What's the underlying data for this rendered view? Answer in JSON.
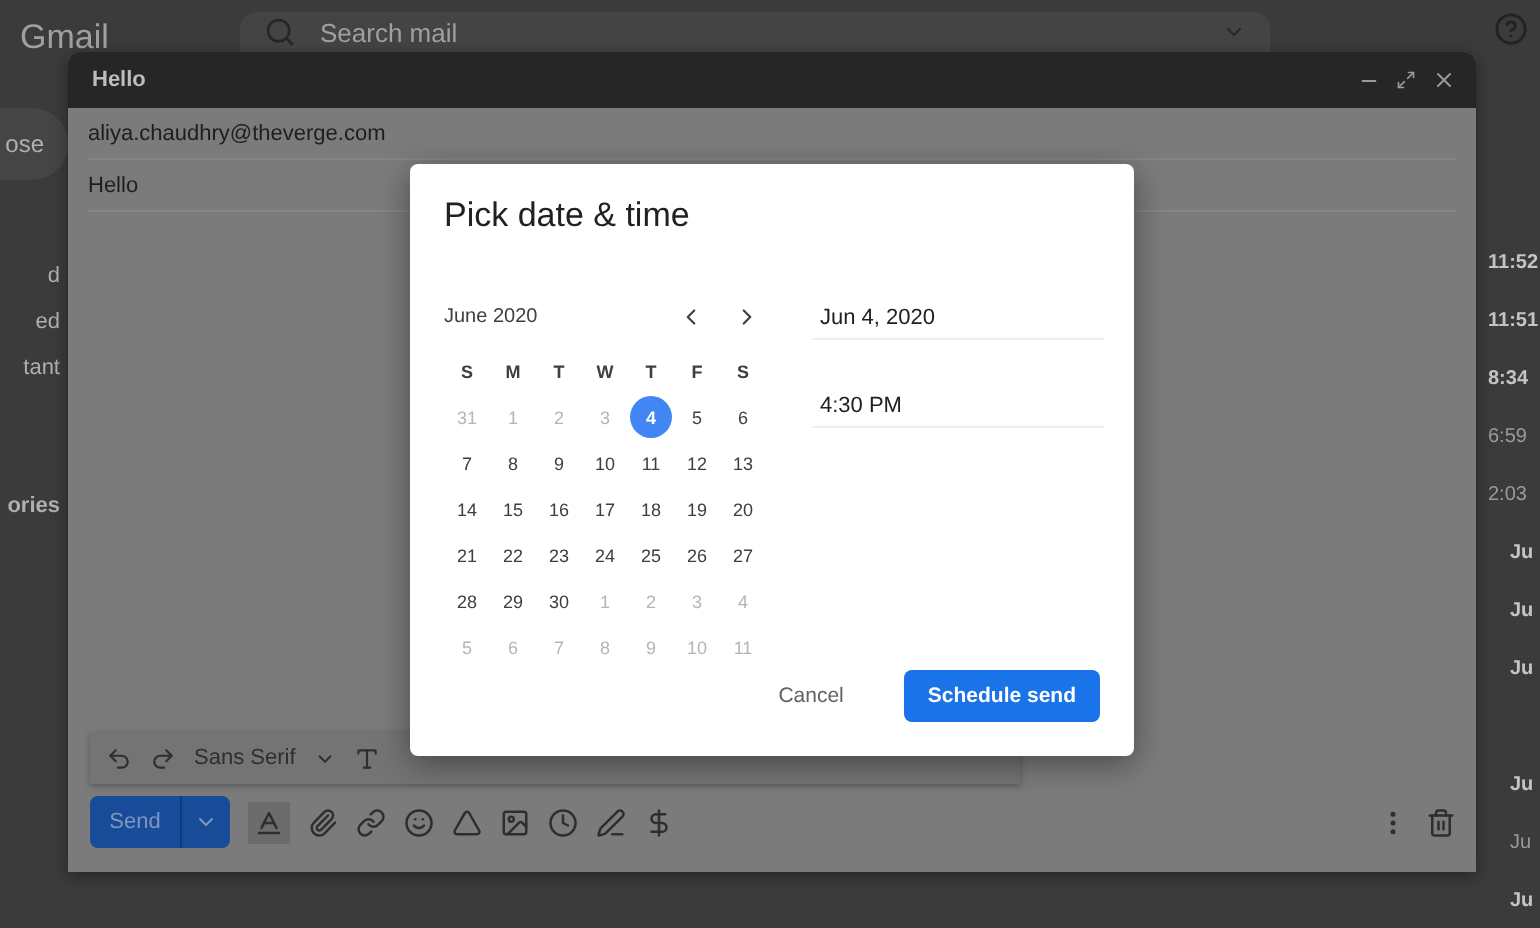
{
  "app": {
    "logo": "Gmail",
    "search": {
      "placeholder": "Search mail"
    }
  },
  "sidebar": {
    "compose": "ose",
    "items": [
      {
        "label": "d",
        "bold": false
      },
      {
        "label": "ed",
        "bold": false
      },
      {
        "label": "tant",
        "bold": false
      }
    ],
    "section": "ories"
  },
  "message_groups": [
    {
      "times": [
        {
          "text": "11:52",
          "kind": "time",
          "unread": true
        },
        {
          "text": "11:51",
          "kind": "time",
          "unread": true
        },
        {
          "text": "8:34",
          "kind": "time",
          "unread": true
        },
        {
          "text": "6:59",
          "kind": "time",
          "unread": false
        },
        {
          "text": "2:03",
          "kind": "time",
          "unread": false
        },
        {
          "text": "Ju",
          "kind": "date",
          "unread": true
        },
        {
          "text": "Ju",
          "kind": "date",
          "unread": true
        },
        {
          "text": "Ju",
          "kind": "date",
          "unread": true
        }
      ]
    },
    {
      "times": [
        {
          "text": "Ju",
          "kind": "date",
          "unread": true
        },
        {
          "text": "Ju",
          "kind": "date",
          "unread": false
        },
        {
          "text": "Ju",
          "kind": "date",
          "unread": true
        }
      ]
    }
  ],
  "compose": {
    "title": "Hello",
    "to": "aliya.chaudhry@theverge.com",
    "subject": "Hello",
    "font": "Sans Serif",
    "send": "Send"
  },
  "dialog": {
    "title": "Pick date & time",
    "month": "June 2020",
    "weekdays": [
      "S",
      "M",
      "T",
      "W",
      "T",
      "F",
      "S"
    ],
    "days": [
      {
        "day": "31",
        "outside": true,
        "selected": false
      },
      {
        "day": "1",
        "outside": true,
        "selected": false
      },
      {
        "day": "2",
        "outside": true,
        "selected": false
      },
      {
        "day": "3",
        "outside": true,
        "selected": false
      },
      {
        "day": "4",
        "outside": false,
        "selected": true
      },
      {
        "day": "5",
        "outside": false,
        "selected": false
      },
      {
        "day": "6",
        "outside": false,
        "selected": false
      },
      {
        "day": "7",
        "outside": false,
        "selected": false
      },
      {
        "day": "8",
        "outside": false,
        "selected": false
      },
      {
        "day": "9",
        "outside": false,
        "selected": false
      },
      {
        "day": "10",
        "outside": false,
        "selected": false
      },
      {
        "day": "11",
        "outside": false,
        "selected": false
      },
      {
        "day": "12",
        "outside": false,
        "selected": false
      },
      {
        "day": "13",
        "outside": false,
        "selected": false
      },
      {
        "day": "14",
        "outside": false,
        "selected": false
      },
      {
        "day": "15",
        "outside": false,
        "selected": false
      },
      {
        "day": "16",
        "outside": false,
        "selected": false
      },
      {
        "day": "17",
        "outside": false,
        "selected": false
      },
      {
        "day": "18",
        "outside": false,
        "selected": false
      },
      {
        "day": "19",
        "outside": false,
        "selected": false
      },
      {
        "day": "20",
        "outside": false,
        "selected": false
      },
      {
        "day": "21",
        "outside": false,
        "selected": false
      },
      {
        "day": "22",
        "outside": false,
        "selected": false
      },
      {
        "day": "23",
        "outside": false,
        "selected": false
      },
      {
        "day": "24",
        "outside": false,
        "selected": false
      },
      {
        "day": "25",
        "outside": false,
        "selected": false
      },
      {
        "day": "26",
        "outside": false,
        "selected": false
      },
      {
        "day": "27",
        "outside": false,
        "selected": false
      },
      {
        "day": "28",
        "outside": false,
        "selected": false
      },
      {
        "day": "29",
        "outside": false,
        "selected": false
      },
      {
        "day": "30",
        "outside": false,
        "selected": false
      },
      {
        "day": "1",
        "outside": true,
        "selected": false
      },
      {
        "day": "2",
        "outside": true,
        "selected": false
      },
      {
        "day": "3",
        "outside": true,
        "selected": false
      },
      {
        "day": "4",
        "outside": true,
        "selected": false
      },
      {
        "day": "5",
        "outside": true,
        "selected": false
      },
      {
        "day": "6",
        "outside": true,
        "selected": false
      },
      {
        "day": "7",
        "outside": true,
        "selected": false
      },
      {
        "day": "8",
        "outside": true,
        "selected": false
      },
      {
        "day": "9",
        "outside": true,
        "selected": false
      },
      {
        "day": "10",
        "outside": true,
        "selected": false
      },
      {
        "day": "11",
        "outside": true,
        "selected": false
      }
    ],
    "date": "Jun 4, 2020",
    "time": "4:30 PM",
    "buttons": [
      {
        "label": "Cancel",
        "kind": "text"
      },
      {
        "label": "Schedule send",
        "kind": "primary"
      }
    ]
  }
}
